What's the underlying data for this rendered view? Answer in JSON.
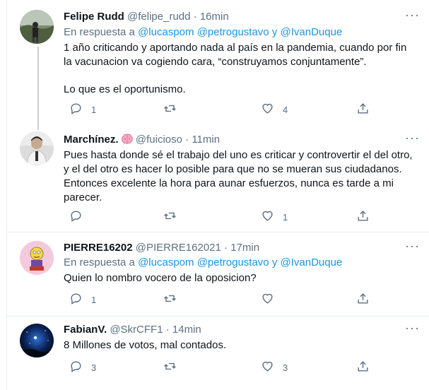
{
  "tweets": [
    {
      "name": "Felipe Rudd",
      "handle": "@felipe_rudd",
      "dot": "·",
      "time": "16min",
      "more": "···",
      "reply_prefix": "En respuesta a",
      "mentions": [
        "@lucaspom",
        "@petrogustavo",
        "@IvanDuque"
      ],
      "mention_joiner": "y",
      "text_lines": [
        "1 año criticando y aportando nada al país en la pandemia, cuando por fin la vacunacion va cogiendo cara, “construyamos conjuntamente”.",
        "Lo que es el oportunismo."
      ],
      "reply_count": "1",
      "retweet_count": "",
      "like_count": "4"
    },
    {
      "name": "Marchínez.",
      "handle": "@fuicioso",
      "dot": "·",
      "time": "11min",
      "more": "···",
      "text_lines": [
        "Pues hasta donde sé el trabajo del uno es criticar y controvertir el del otro, y el del otro es hacer lo posible para que no se mueran sus ciudadanos. Entonces excelente la hora para aunar esfuerzos, nunca es tarde a mi parecer."
      ],
      "reply_count": "",
      "retweet_count": "",
      "like_count": "1"
    },
    {
      "name": "PIERRE16202",
      "handle": "@PIERRE162021",
      "dot": "·",
      "time": "17min",
      "more": "···",
      "reply_prefix": "En respuesta a",
      "mentions": [
        "@lucaspom",
        "@petrogustavo",
        "@IvanDuque"
      ],
      "mention_joiner": "y",
      "text_lines": [
        "Quien lo nombro vocero de la oposicion?"
      ],
      "reply_count": "1",
      "retweet_count": "",
      "like_count": ""
    },
    {
      "name": "FabianV.",
      "handle": "@SkrCFF1",
      "dot": "·",
      "time": "14min",
      "more": "···",
      "text_lines": [
        "8 Millones de votos, mal contados."
      ],
      "reply_count": "3",
      "retweet_count": "",
      "like_count": "3"
    }
  ],
  "icons": {
    "reply": "reply-icon",
    "retweet": "retweet-icon",
    "like": "heart-icon",
    "share": "share-icon",
    "brain": "brain-emoji"
  },
  "colors": {
    "link": "#1b95e0",
    "muted": "#5b7083",
    "border": "#e6ecf0",
    "thread": "#c4cfd6"
  }
}
